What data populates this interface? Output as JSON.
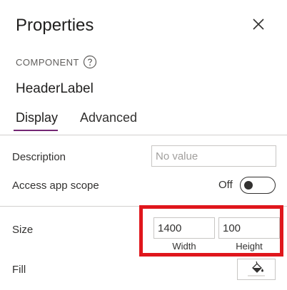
{
  "panel": {
    "title": "Properties",
    "close_icon": "close-icon"
  },
  "component": {
    "section_label": "COMPONENT",
    "help_icon": "help-circle-icon",
    "name": "HeaderLabel"
  },
  "tabs": [
    {
      "label": "Display",
      "active": true
    },
    {
      "label": "Advanced",
      "active": false
    }
  ],
  "colors": {
    "accent": "#742774",
    "highlight": "#e0161c"
  },
  "properties": {
    "description": {
      "label": "Description",
      "value": "",
      "placeholder": "No value"
    },
    "access_app_scope": {
      "label": "Access app scope",
      "state_text": "Off",
      "on": false
    },
    "size": {
      "label": "Size",
      "width": {
        "value": "1400",
        "caption": "Width"
      },
      "height": {
        "value": "100",
        "caption": "Height"
      }
    },
    "fill": {
      "label": "Fill",
      "icon": "paint-bucket-icon"
    }
  }
}
